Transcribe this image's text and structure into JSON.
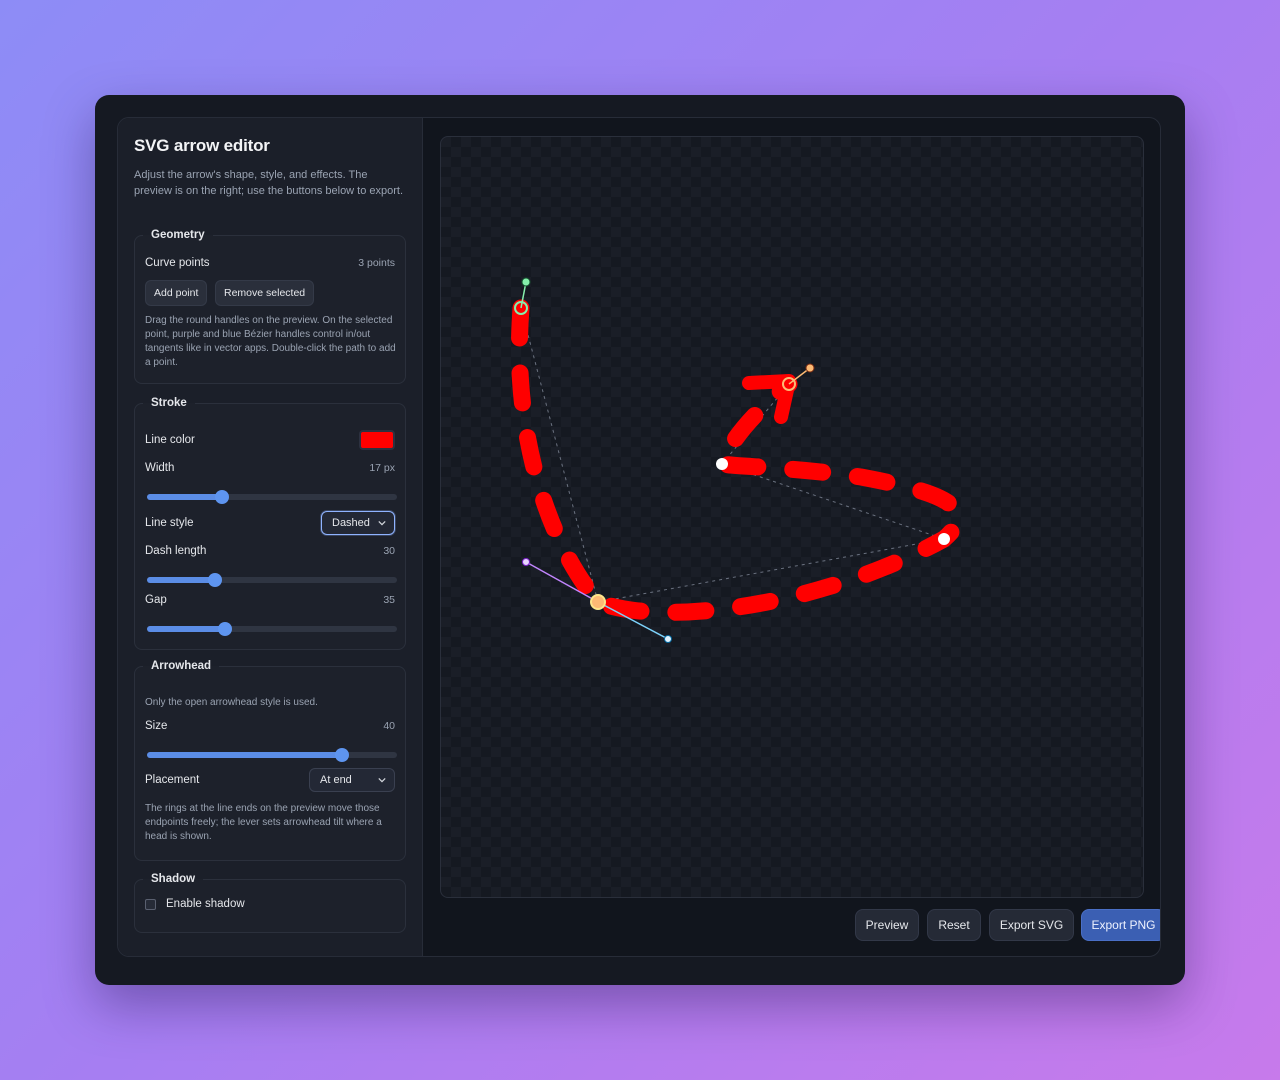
{
  "sidebar": {
    "title": "SVG arrow editor",
    "description": "Adjust the arrow's shape, style, and effects. The preview is on the right; use the buttons below to export.",
    "geometry": {
      "legend": "Geometry",
      "curve_points_label": "Curve points",
      "curve_points_count": "3 points",
      "add_point": "Add point",
      "remove_selected": "Remove selected",
      "note": "Drag the round handles on the preview. On the selected point, purple and blue Bézier handles control in/out tangents like in vector apps. Double-click the path to add a point."
    },
    "stroke": {
      "legend": "Stroke",
      "line_color_label": "Line color",
      "line_color": "#ff0000",
      "width_label": "Width",
      "width_value": "17 px",
      "width_fraction": 0.3,
      "line_style_label": "Line style",
      "line_style": "Dashed",
      "dash_length_label": "Dash length",
      "dash_length_value": "30",
      "dash_fraction": 0.27,
      "gap_label": "Gap",
      "gap_value": "35",
      "gap_fraction": 0.31
    },
    "arrowhead": {
      "legend": "Arrowhead",
      "note_top": "Only the open arrowhead style is used.",
      "size_label": "Size",
      "size_value": "40",
      "size_fraction": 0.78,
      "placement_label": "Placement",
      "placement": "At end",
      "note": "The rings at the line ends on the preview move those endpoints freely; the lever sets arrowhead tilt where a head is shown."
    },
    "shadow": {
      "legend": "Shadow",
      "enable_label": "Enable shadow",
      "enabled": false
    }
  },
  "footer": {
    "preview": "Preview",
    "reset": "Reset",
    "export_svg": "Export SVG",
    "export_png": "Export PNG"
  },
  "colors": {
    "accent": "#5b8de6",
    "primary_button": "#3b5fb3",
    "stroke": "#ff0000"
  }
}
